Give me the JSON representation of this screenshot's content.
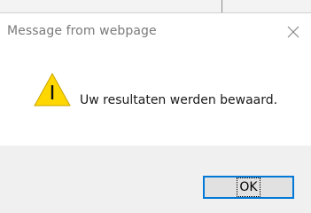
{
  "dialog": {
    "title": "Message from webpage",
    "message": "Uw resultaten werden bewaard.",
    "ok_label": "OK"
  },
  "icons": {
    "close": "close-icon",
    "warning": "warning-icon"
  },
  "colors": {
    "accent": "#0078d7",
    "warning_fill": "#ffd700",
    "title_text": "#7a7a7a",
    "footer_bg": "#f0f0f0"
  }
}
